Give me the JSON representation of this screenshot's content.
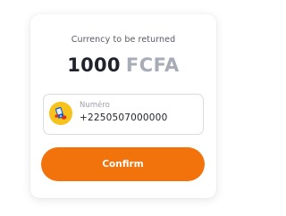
{
  "card": {
    "caption": "Currency to be returned",
    "amount": "1000",
    "currency": "FCFA"
  },
  "phone_field": {
    "label": "Numéro",
    "value": "+2250507000000",
    "operator_icon": "mtn-operator-logo-icon"
  },
  "confirm_button": {
    "label": "Confirm"
  },
  "colors": {
    "accent": "#f2720c",
    "operator": "#f6c21b",
    "amount": "#20232b",
    "currency": "#a7acb6"
  }
}
